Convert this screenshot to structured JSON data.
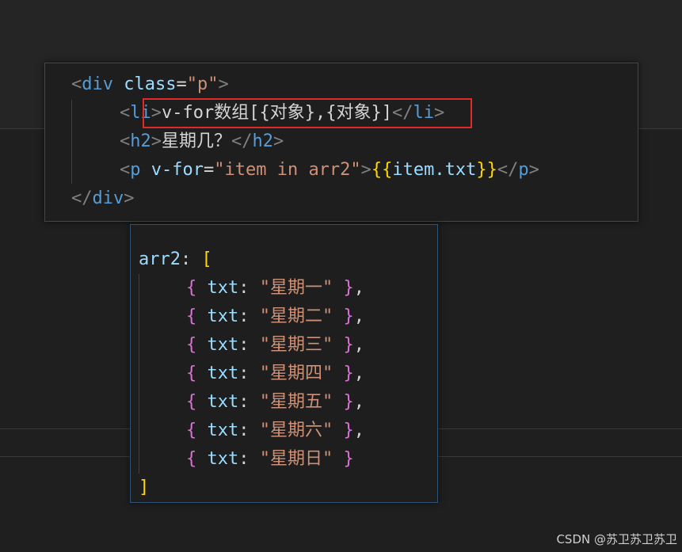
{
  "html_snippet": {
    "line1": {
      "open": "<",
      "tag": "div",
      "attr": "class",
      "eq": "=",
      "val": "\"p\"",
      "close": ">"
    },
    "line2": {
      "open": "<",
      "tag_a": "l",
      "tag_b": "i",
      "close": ">",
      "text": "v-for数组[{对象},{对象}]",
      "end_open": "</",
      "end_tag_a": "l",
      "end_tag_b": "i",
      "end_close": ">"
    },
    "line3": {
      "open": "<",
      "tag": "h2",
      "close": ">",
      "text": "星期几？",
      "end_open": "</",
      "end_tag": "h2",
      "end_close": ">"
    },
    "line4": {
      "open": "<",
      "tag": "p",
      "attr": "v-for",
      "eq": "=",
      "val": "\"item in arr2\"",
      "close": ">",
      "mustache_open": "{{",
      "expr": "item.txt",
      "mustache_close": "}}",
      "end_open": "</",
      "end_tag": "p",
      "end_close": ">"
    },
    "line5": {
      "end_open": "</",
      "end_tag": "div",
      "end_close": ">"
    }
  },
  "data_snippet": {
    "decl": "arr2",
    "colon": ": ",
    "open_bracket": "[",
    "close_bracket": "]",
    "items": [
      {
        "key": "txt",
        "value": "\"星期一\"",
        "trailing": ","
      },
      {
        "key": "txt",
        "value": "\"星期二\"",
        "trailing": ","
      },
      {
        "key": "txt",
        "value": "\"星期三\"",
        "trailing": ","
      },
      {
        "key": "txt",
        "value": "\"星期四\"",
        "trailing": ","
      },
      {
        "key": "txt",
        "value": "\"星期五\"",
        "trailing": ","
      },
      {
        "key": "txt",
        "value": "\"星期六\"",
        "trailing": ","
      },
      {
        "key": "txt",
        "value": "\"星期日\"",
        "trailing": ""
      }
    ]
  },
  "watermark": "CSDN @苏卫苏卫苏卫",
  "colors": {
    "tag": "#569cd6",
    "attr": "#9cdcfe",
    "string": "#ce9178",
    "bracket_gold": "#ffd700",
    "bracket_purple": "#da70d6",
    "highlight_border": "#e02a2a"
  }
}
